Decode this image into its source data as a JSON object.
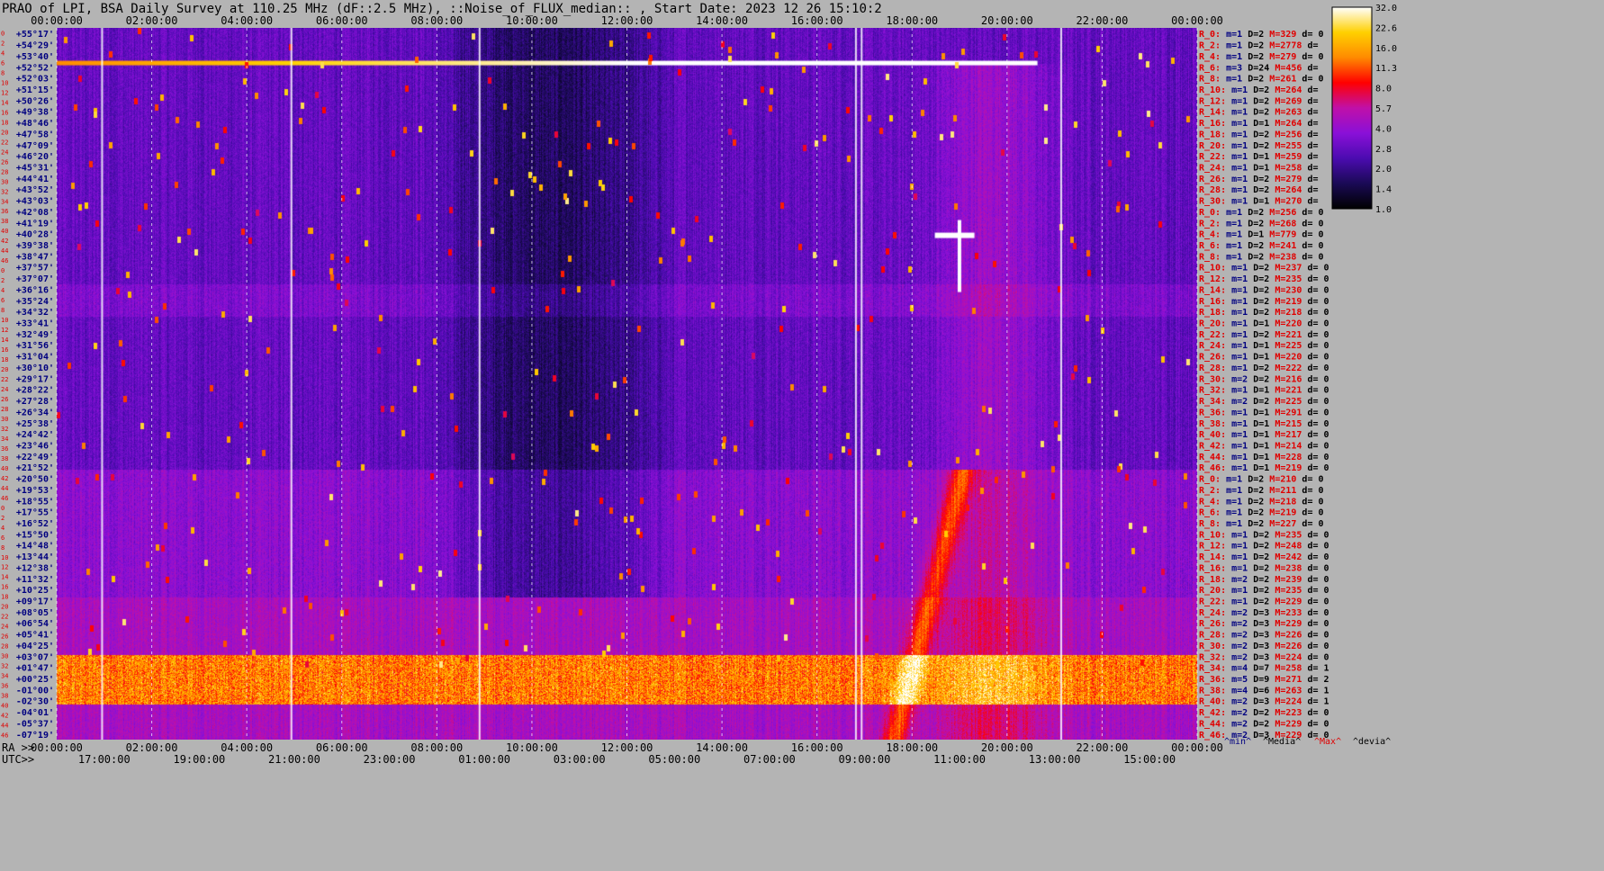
{
  "title": "PRAO of LPI, BSA Daily Survey at 110.25 MHz (dF::2.5 MHz), ::Noise_of_FLUX_median:: , Start Date: 2023 12 26 15:10:2",
  "chart_data": {
    "type": "heatmap",
    "title": "PRAO of LPI, BSA Daily Survey at 110.25 MHz (dF::2.5 MHz), ::Noise_of_FLUX_median:: , Start Date: 2023 12 26 15:10:2",
    "colormap": [
      "#000000",
      "#1a0a55",
      "#4b0bb0",
      "#8a10d8",
      "#c010a8",
      "#ff0000",
      "#ff8a00",
      "#ffd000",
      "#ffffff"
    ],
    "top_axis_ticks": [
      "00:00:00",
      "02:00:00",
      "04:00:00",
      "06:00:00",
      "08:00:00",
      "10:00:00",
      "12:00:00",
      "14:00:00",
      "16:00:00",
      "18:00:00",
      "20:00:00",
      "22:00:00",
      "00:00:00"
    ],
    "ra_axis_label": "RA >>",
    "ra_axis_ticks": [
      "00:00:00",
      "02:00:00",
      "04:00:00",
      "06:00:00",
      "08:00:00",
      "10:00:00",
      "12:00:00",
      "14:00:00",
      "16:00:00",
      "18:00:00",
      "20:00:00",
      "22:00:00",
      "00:00:00"
    ],
    "utc_axis_label": "UTC>>",
    "utc_axis_ticks": [
      "17:00:00",
      "19:00:00",
      "21:00:00",
      "23:00:00",
      "01:00:00",
      "03:00:00",
      "05:00:00",
      "07:00:00",
      "09:00:00",
      "11:00:00",
      "13:00:00",
      "15:00:00"
    ],
    "declinations": [
      "+55°17'",
      "+54°29'",
      "+53°40'",
      "+52°52'",
      "+52°03'",
      "+51°15'",
      "+50°26'",
      "+49°38'",
      "+48°46'",
      "+47°58'",
      "+47°09'",
      "+46°20'",
      "+45°31'",
      "+44°41'",
      "+43°52'",
      "+43°03'",
      "+42°08'",
      "+41°19'",
      "+40°28'",
      "+39°38'",
      "+38°47'",
      "+37°57'",
      "+37°07'",
      "+36°16'",
      "+35°24'",
      "+34°32'",
      "+33°41'",
      "+32°49'",
      "+31°56'",
      "+31°04'",
      "+30°10'",
      "+29°17'",
      "+28°22'",
      "+27°28'",
      "+26°34'",
      "+25°38'",
      "+24°42'",
      "+23°46'",
      "+22°49'",
      "+21°52'",
      "+20°50'",
      "+19°53'",
      "+18°55'",
      "+17°55'",
      "+16°52'",
      "+15°50'",
      "+14°48'",
      "+13°44'",
      "+12°38'",
      "+11°32'",
      "+10°25'",
      "+09°17'",
      "+08°05'",
      "+06°54'",
      "+05°41'",
      "+04°25'",
      "+03°07'",
      "+01°47'",
      "+00°25'",
      "-01°00'",
      "-02°30'",
      "-04°01'",
      "-05°37'",
      "-07°19'"
    ],
    "channel_numbers": [
      "0",
      "2",
      "4",
      "6",
      "8",
      "10",
      "12",
      "14",
      "16",
      "18",
      "20",
      "22",
      "24",
      "26",
      "28",
      "30",
      "32",
      "34",
      "36",
      "38",
      "40",
      "42",
      "44",
      "46",
      "0",
      "2",
      "4",
      "6",
      "8",
      "10",
      "12",
      "14",
      "16",
      "18",
      "20",
      "22",
      "24",
      "26",
      "28",
      "30",
      "32",
      "34",
      "36",
      "38",
      "40",
      "42",
      "44",
      "46",
      "0",
      "2",
      "4",
      "6",
      "8",
      "10",
      "12",
      "14",
      "16",
      "18",
      "20",
      "22",
      "24",
      "26",
      "28",
      "30",
      "32",
      "34",
      "36",
      "38",
      "40",
      "42",
      "44",
      "46"
    ],
    "stats_rows": [
      [
        "R_0:",
        "m=1",
        "D=2",
        "M=329",
        "d= 0"
      ],
      [
        "R_2:",
        "m=1",
        "D=2",
        "M=2778",
        "d="
      ],
      [
        "R_4:",
        "m=1",
        "D=2",
        "M=279",
        "d= 0"
      ],
      [
        "R_6:",
        "m=3",
        "D=24",
        "M=456",
        "d="
      ],
      [
        "R_8:",
        "m=1",
        "D=2",
        "M=261",
        "d= 0"
      ],
      [
        "R_10:",
        "m=1",
        "D=2",
        "M=264",
        "d="
      ],
      [
        "R_12:",
        "m=1",
        "D=2",
        "M=269",
        "d="
      ],
      [
        "R_14:",
        "m=1",
        "D=2",
        "M=263",
        "d="
      ],
      [
        "R_16:",
        "m=1",
        "D=1",
        "M=264",
        "d="
      ],
      [
        "R_18:",
        "m=1",
        "D=2",
        "M=256",
        "d="
      ],
      [
        "R_20:",
        "m=1",
        "D=2",
        "M=255",
        "d="
      ],
      [
        "R_22:",
        "m=1",
        "D=1",
        "M=259",
        "d="
      ],
      [
        "R_24:",
        "m=1",
        "D=1",
        "M=258",
        "d="
      ],
      [
        "R_26:",
        "m=1",
        "D=2",
        "M=279",
        "d="
      ],
      [
        "R_28:",
        "m=1",
        "D=2",
        "M=264",
        "d="
      ],
      [
        "R_30:",
        "m=1",
        "D=1",
        "M=270",
        "d="
      ],
      [
        "R_0:",
        "m=1",
        "D=2",
        "M=256",
        "d= 0"
      ],
      [
        "R_2:",
        "m=1",
        "D=2",
        "M=268",
        "d= 0"
      ],
      [
        "R_4:",
        "m=1",
        "D=1",
        "M=779",
        "d= 0"
      ],
      [
        "R_6:",
        "m=1",
        "D=2",
        "M=241",
        "d= 0"
      ],
      [
        "R_8:",
        "m=1",
        "D=2",
        "M=238",
        "d= 0"
      ],
      [
        "R_10:",
        "m=1",
        "D=2",
        "M=237",
        "d= 0"
      ],
      [
        "R_12:",
        "m=1",
        "D=2",
        "M=235",
        "d= 0"
      ],
      [
        "R_14:",
        "m=1",
        "D=2",
        "M=230",
        "d= 0"
      ],
      [
        "R_16:",
        "m=1",
        "D=2",
        "M=219",
        "d= 0"
      ],
      [
        "R_18:",
        "m=1",
        "D=2",
        "M=218",
        "d= 0"
      ],
      [
        "R_20:",
        "m=1",
        "D=1",
        "M=220",
        "d= 0"
      ],
      [
        "R_22:",
        "m=1",
        "D=2",
        "M=221",
        "d= 0"
      ],
      [
        "R_24:",
        "m=1",
        "D=1",
        "M=225",
        "d= 0"
      ],
      [
        "R_26:",
        "m=1",
        "D=1",
        "M=220",
        "d= 0"
      ],
      [
        "R_28:",
        "m=1",
        "D=2",
        "M=222",
        "d= 0"
      ],
      [
        "R_30:",
        "m=2",
        "D=2",
        "M=216",
        "d= 0"
      ],
      [
        "R_32:",
        "m=1",
        "D=1",
        "M=221",
        "d= 0"
      ],
      [
        "R_34:",
        "m=2",
        "D=2",
        "M=225",
        "d= 0"
      ],
      [
        "R_36:",
        "m=1",
        "D=1",
        "M=291",
        "d= 0"
      ],
      [
        "R_38:",
        "m=1",
        "D=1",
        "M=215",
        "d= 0"
      ],
      [
        "R_40:",
        "m=1",
        "D=1",
        "M=217",
        "d= 0"
      ],
      [
        "R_42:",
        "m=1",
        "D=1",
        "M=214",
        "d= 0"
      ],
      [
        "R_44:",
        "m=1",
        "D=1",
        "M=228",
        "d= 0"
      ],
      [
        "R_46:",
        "m=1",
        "D=1",
        "M=219",
        "d= 0"
      ],
      [
        "R_0:",
        "m=1",
        "D=2",
        "M=210",
        "d= 0"
      ],
      [
        "R_2:",
        "m=1",
        "D=2",
        "M=211",
        "d= 0"
      ],
      [
        "R_4:",
        "m=1",
        "D=2",
        "M=218",
        "d= 0"
      ],
      [
        "R_6:",
        "m=1",
        "D=2",
        "M=219",
        "d= 0"
      ],
      [
        "R_8:",
        "m=1",
        "D=2",
        "M=227",
        "d= 0"
      ],
      [
        "R_10:",
        "m=1",
        "D=2",
        "M=235",
        "d= 0"
      ],
      [
        "R_12:",
        "m=1",
        "D=2",
        "M=248",
        "d= 0"
      ],
      [
        "R_14:",
        "m=1",
        "D=2",
        "M=242",
        "d= 0"
      ],
      [
        "R_16:",
        "m=1",
        "D=2",
        "M=238",
        "d= 0"
      ],
      [
        "R_18:",
        "m=2",
        "D=2",
        "M=239",
        "d= 0"
      ],
      [
        "R_20:",
        "m=1",
        "D=2",
        "M=235",
        "d= 0"
      ],
      [
        "R_22:",
        "m=1",
        "D=2",
        "M=229",
        "d= 0"
      ],
      [
        "R_24:",
        "m=2",
        "D=3",
        "M=233",
        "d= 0"
      ],
      [
        "R_26:",
        "m=2",
        "D=3",
        "M=229",
        "d= 0"
      ],
      [
        "R_28:",
        "m=2",
        "D=3",
        "M=226",
        "d= 0"
      ],
      [
        "R_30:",
        "m=2",
        "D=3",
        "M=226",
        "d= 0"
      ],
      [
        "R_32:",
        "m=2",
        "D=3",
        "M=224",
        "d= 0"
      ],
      [
        "R_34:",
        "m=4",
        "D=7",
        "M=258",
        "d= 1"
      ],
      [
        "R_36:",
        "m=5",
        "D=9",
        "M=271",
        "d= 2"
      ],
      [
        "R_38:",
        "m=4",
        "D=6",
        "M=263",
        "d= 1"
      ],
      [
        "R_40:",
        "m=2",
        "D=3",
        "M=224",
        "d= 1"
      ],
      [
        "R_42:",
        "m=2",
        "D=2",
        "M=223",
        "d= 0"
      ],
      [
        "R_44:",
        "m=2",
        "D=2",
        "M=229",
        "d= 0"
      ],
      [
        "R_46:",
        "m=2",
        "D=3",
        "M=229",
        "d= 0"
      ]
    ],
    "stats_footer": [
      "^min^",
      "^Media^",
      "^Max^",
      "^devia^"
    ],
    "colorbar_ticks": [
      "32.0",
      "22.6",
      "16.0",
      "11.3",
      "8.0",
      "5.7",
      "4.0",
      "2.8",
      "2.0",
      "1.4",
      "1.0"
    ],
    "colors": {
      "background": "#b4b4b4",
      "label_red": "#e00000",
      "label_blue": "#000080"
    }
  }
}
